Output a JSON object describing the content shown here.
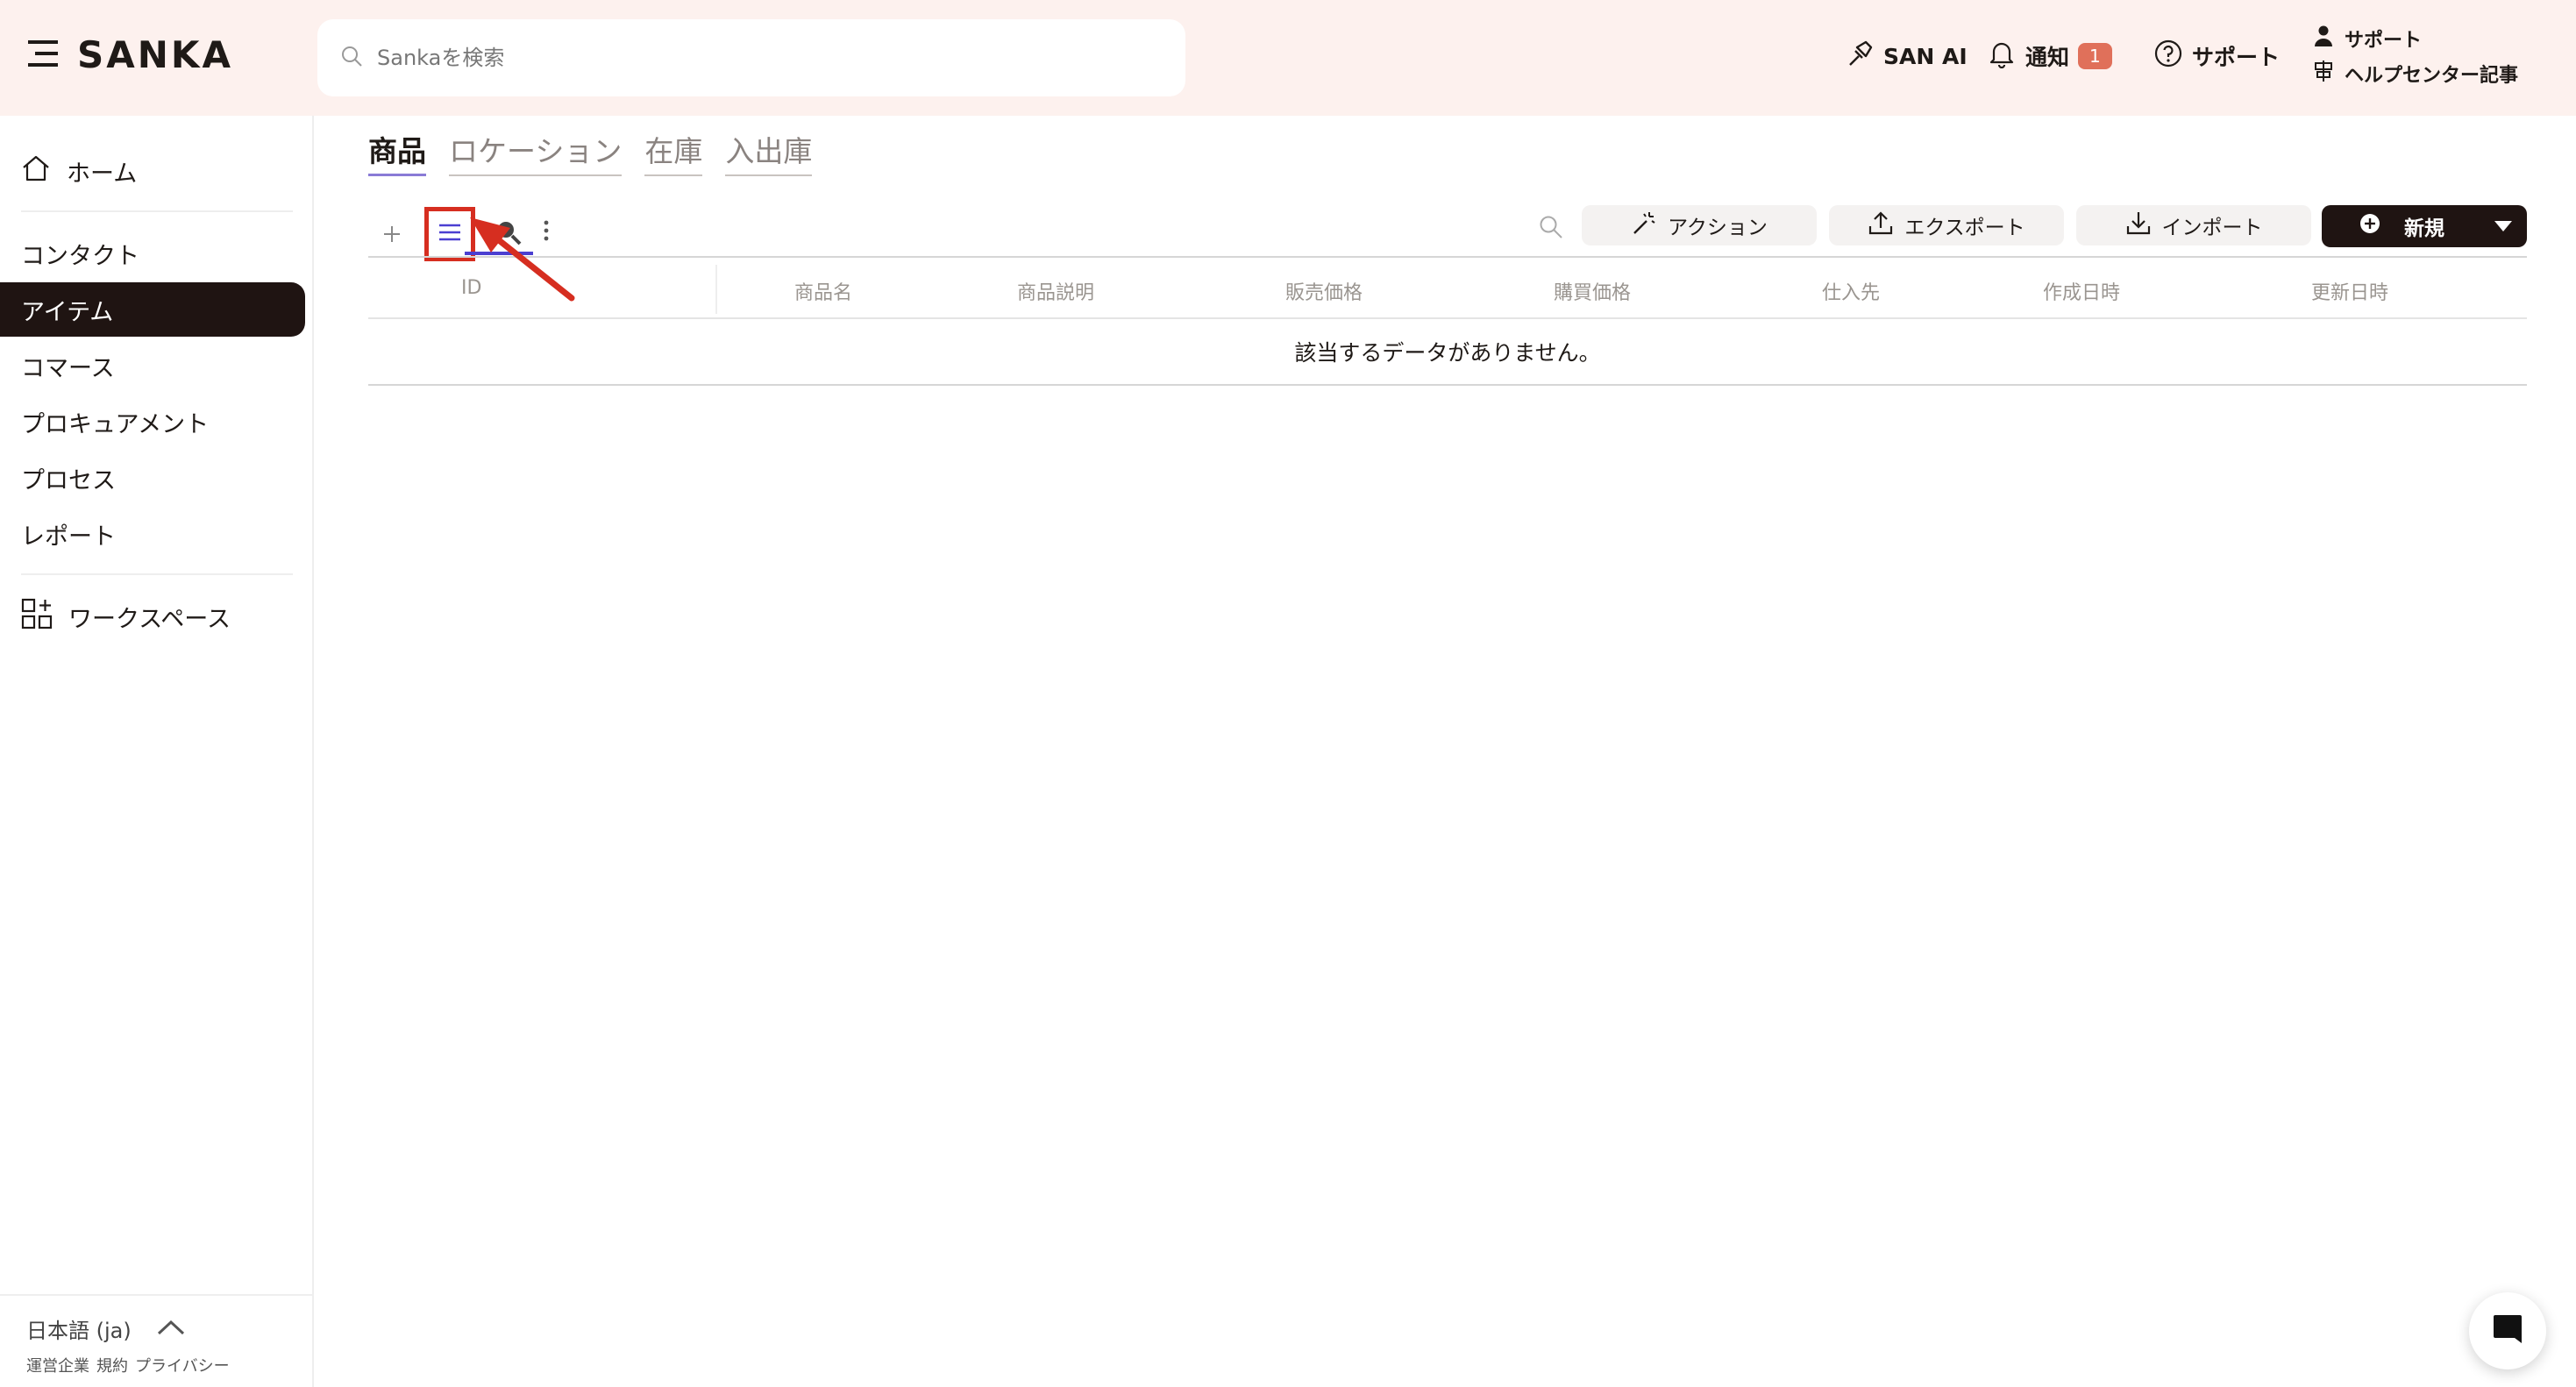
{
  "header": {
    "brand": "SANKA",
    "search_placeholder": "Sankaを検索",
    "san_ai": "SAN AI",
    "notifications_label": "通知",
    "notifications_count": "1",
    "support_label": "サポート",
    "support_link": "サポート",
    "help_center": "ヘルプセンター記事"
  },
  "sidebar": {
    "home": "ホーム",
    "items": [
      "コンタクト",
      "アイテム",
      "コマース",
      "プロキュアメント",
      "プロセス",
      "レポート"
    ],
    "active_index": 1,
    "workspace": "ワークスペース",
    "language": "日本語 (ja)",
    "footer_links": [
      "運営企業",
      "規約",
      "プライバシー"
    ]
  },
  "main": {
    "tabs": [
      "商品",
      "ロケーション",
      "在庫",
      "入出庫"
    ],
    "active_tab": 0,
    "toolbar": {
      "action": "アクション",
      "export": "エクスポート",
      "import": "インポート",
      "new": "新規"
    },
    "table": {
      "columns": [
        "ID",
        "商品名",
        "商品説明",
        "販売価格",
        "購買価格",
        "仕入先",
        "作成日時",
        "更新日時"
      ],
      "empty_message": "該当するデータがありません。"
    }
  },
  "colors": {
    "header_bg": "#fdf1ee",
    "dark": "#1f1412",
    "badge": "#e0705a",
    "highlight": "#d62e20",
    "accent": "#4b3fd1"
  }
}
